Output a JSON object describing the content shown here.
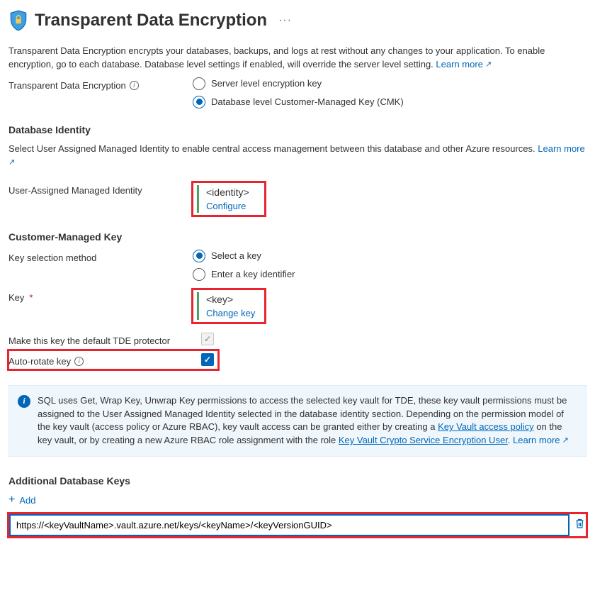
{
  "header": {
    "title": "Transparent Data Encryption"
  },
  "intro": {
    "text": "Transparent Data Encryption encrypts your databases, backups, and logs at rest without any changes to your application. To enable encryption, go to each database. Database level settings if enabled, will override the server level setting.",
    "learn_more": "Learn more"
  },
  "tde_mode": {
    "label": "Transparent Data Encryption",
    "opt_server": "Server level encryption key",
    "opt_db": "Database level Customer-Managed Key (CMK)"
  },
  "identity_section": {
    "title": "Database Identity",
    "desc": "Select User Assigned Managed Identity to enable central access management between this database and other Azure resources.",
    "learn_more": "Learn more",
    "field_label": "User-Assigned Managed Identity",
    "value": "<identity>",
    "action": "Configure"
  },
  "cmk_section": {
    "title": "Customer-Managed Key",
    "selection_label": "Key selection method",
    "opt_select": "Select a key",
    "opt_enter": "Enter a key identifier",
    "key_label": "Key",
    "key_value": "<key>",
    "key_action": "Change key",
    "default_protector_label": "Make this key the default TDE protector",
    "autorotate_label": "Auto-rotate key"
  },
  "infobox": {
    "text1": "SQL uses Get, Wrap Key, Unwrap Key permissions to access the selected key vault for TDE, these key vault permissions must be assigned to the User Assigned Managed Identity selected in the database identity section. Depending on the permission model of the key vault (access policy or Azure RBAC), key vault access can be granted either by creating a ",
    "link1": "Key Vault access policy",
    "text2": " on the key vault, or by creating a new Azure RBAC role assignment with the role ",
    "link2": "Key Vault Crypto Service Encryption User",
    "text3": ". ",
    "learn_more": "Learn more"
  },
  "additional_keys": {
    "title": "Additional Database Keys",
    "add_label": "Add",
    "input_value": "https://<keyVaultName>.vault.azure.net/keys/<keyName>/<keyVersionGUID>"
  }
}
